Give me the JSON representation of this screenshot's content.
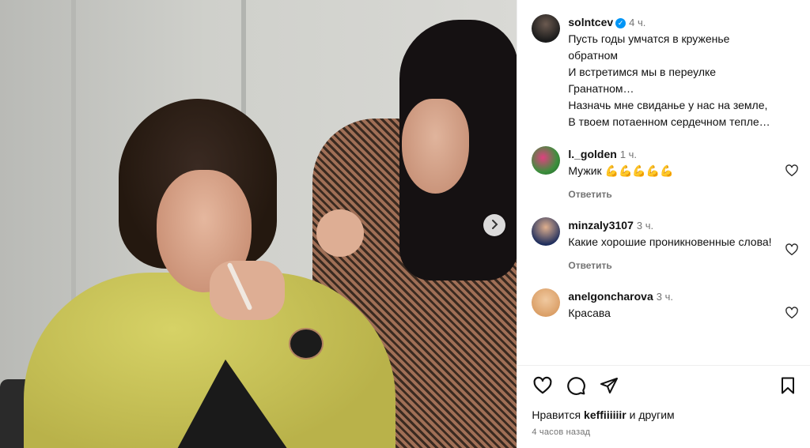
{
  "post": {
    "author": "solntcev",
    "time": "4 ч.",
    "caption_lines": [
      "Пусть годы умчатся в круженье",
      "обратном",
      "И встретимся мы в переулке",
      "Гранатном…",
      "Назначь мне свиданье у нас на земле,",
      "В твоем потаенном сердечном тепле…"
    ]
  },
  "comments": [
    {
      "user": "l._golden",
      "time": "1 ч.",
      "text": "Мужик 💪💪💪💪💪",
      "reply": "Ответить"
    },
    {
      "user": "minzaly3107",
      "time": "3 ч.",
      "text": "Какие хорошие проникновенные слова!",
      "reply": "Ответить"
    },
    {
      "user": "anelgoncharova",
      "time": "3 ч.",
      "text": "Красава"
    }
  ],
  "likes": {
    "prefix": "Нравится",
    "user": "keffiiiiiir",
    "suffix": "и другим"
  },
  "posted_ago": "4 часов назад",
  "icons": {
    "verified": "verified-badge-icon",
    "like": "heart-icon",
    "comment": "comment-bubble-icon",
    "share": "paper-plane-icon",
    "save": "bookmark-icon",
    "next": "chevron-right-icon"
  },
  "colors": {
    "verified": "#0095f6",
    "muted": "#737373"
  }
}
